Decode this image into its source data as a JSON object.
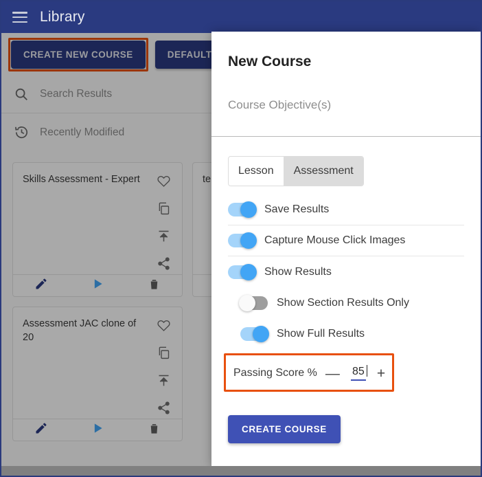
{
  "header": {
    "title": "Library",
    "menu_icon": "hamburger-icon"
  },
  "toolbar": {
    "create_new_course_label": "CREATE NEW COURSE",
    "defaults_label": "DEFAULTS",
    "search_label": "Se"
  },
  "library": {
    "search_results_label": "Search Results",
    "search_results_icon": "search-icon",
    "recently_modified_label": "Recently Modified",
    "recently_modified_icon": "history-icon",
    "cards": [
      {
        "title": "Skills Assessment - Expert"
      },
      {
        "title": "te"
      },
      {
        "title": "Assessment JAC clone of 20"
      }
    ],
    "card_actions": {
      "favorite": "heart-icon",
      "duplicate": "copy-icon",
      "publish": "publish-icon",
      "share": "share-icon",
      "edit": "pencil-icon",
      "play": "play-icon",
      "delete": "trash-icon"
    }
  },
  "dialog": {
    "title": "New Course",
    "objective_placeholder": "Course Objective(s)",
    "tabs": [
      {
        "label": "Lesson",
        "selected": false
      },
      {
        "label": "Assessment",
        "selected": true
      }
    ],
    "toggles": [
      {
        "label": "Save Results",
        "on": true,
        "indented": false
      },
      {
        "label": "Capture Mouse Click Images",
        "on": true,
        "indented": false
      },
      {
        "label": "Show Results",
        "on": true,
        "indented": false
      },
      {
        "label": "Show Section Results Only",
        "on": false,
        "indented": true
      },
      {
        "label": "Show Full Results",
        "on": true,
        "indented": false
      }
    ],
    "passing_score": {
      "label": "Passing Score %",
      "value": "85",
      "decrement_label": "—",
      "increment_label": "+"
    },
    "create_course_label": "CREATE COURSE"
  },
  "highlights": {
    "color": "#e8500e",
    "targets": [
      "create-new-course-button",
      "passing-score-field"
    ]
  },
  "colors": {
    "header_navy": "#2a3a80",
    "primary_button": "#3f51b5",
    "toggle_on_track": "#a4d4fa",
    "toggle_on_knob": "#42a5f5",
    "toggle_off_track": "#9e9e9e",
    "highlight_orange": "#e8500e"
  }
}
